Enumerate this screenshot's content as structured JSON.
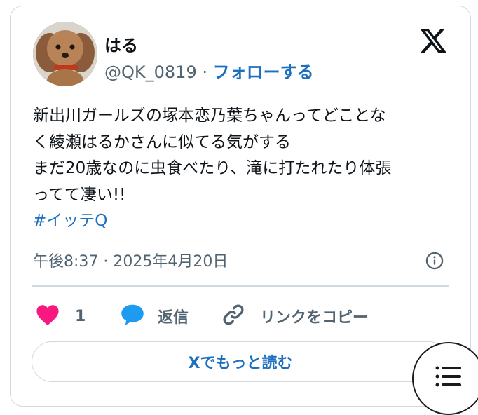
{
  "author": {
    "display_name": "はる",
    "handle": "@QK_0819",
    "separator": "·",
    "follow_label": "フォローする"
  },
  "tweet": {
    "lines": [
      "新出川ガールズの塚本恋乃葉ちゃんってどことな",
      "く綾瀬はるかさんに似てる気がする",
      "まだ20歳なのに虫食べたり、滝に打たれたり体張",
      "ってて凄い!!"
    ],
    "hashtag": "#イッテQ",
    "timestamp": "午後8:37 · 2025年4月20日"
  },
  "actions": {
    "like_count": "1",
    "reply_label": "返信",
    "copy_link_label": "リンクをコピー"
  },
  "read_more_label": "Xでもっと読む",
  "colors": {
    "link": "#1d6fbf",
    "heart": "#f91880",
    "reply_bubble": "#1d9bf0",
    "muted_text": "#536471",
    "border": "#cfd9de"
  },
  "icons": [
    "x-logo-icon",
    "info-icon",
    "heart-icon",
    "reply-bubble-icon",
    "link-icon",
    "list-menu-icon"
  ]
}
